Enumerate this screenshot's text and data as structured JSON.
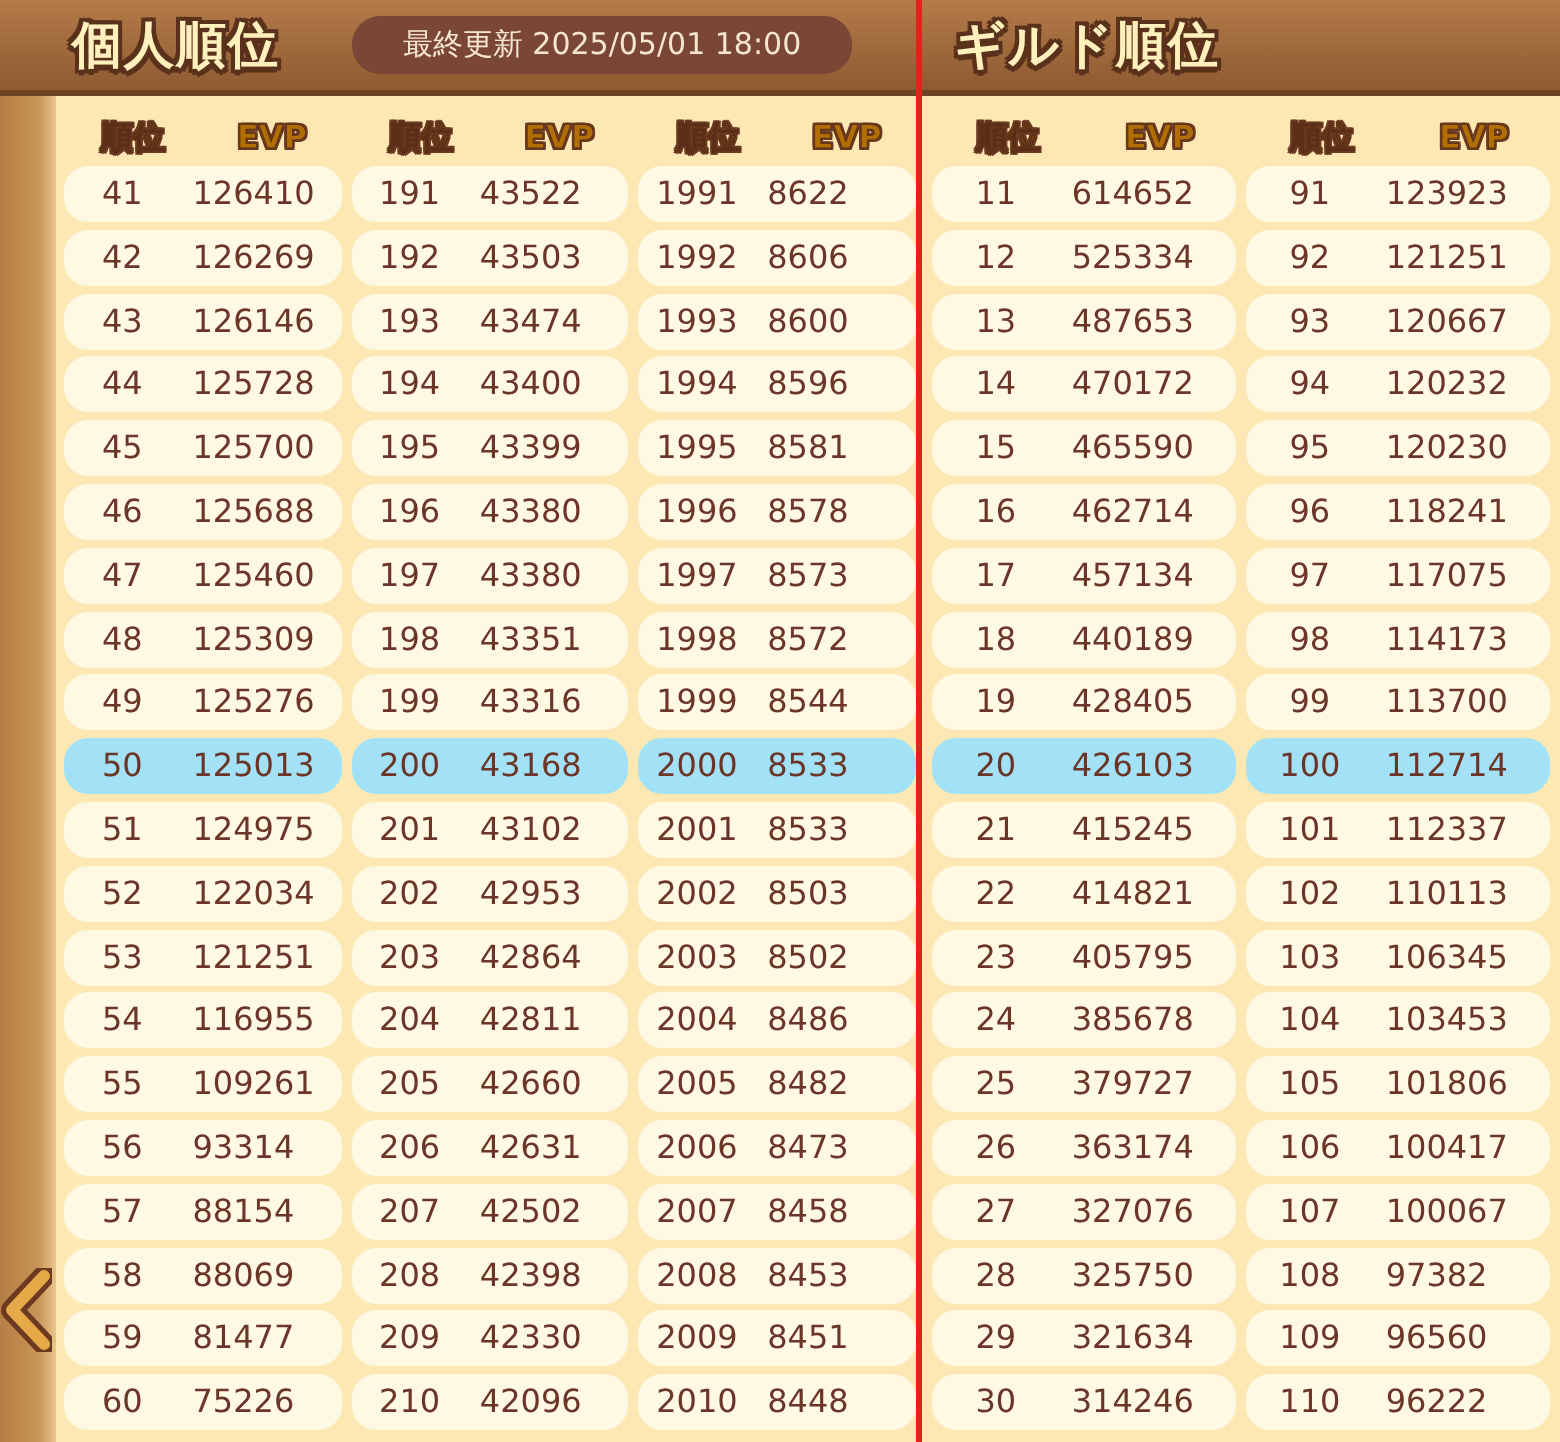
{
  "personal": {
    "title": "個人順位",
    "updated": "最終更新 2025/05/01 18:00",
    "columns": [
      {
        "rank_header": "順位",
        "evp_header": "EVP",
        "rows": [
          {
            "rank": "41",
            "evp": "126410",
            "selected": false
          },
          {
            "rank": "42",
            "evp": "126269",
            "selected": false
          },
          {
            "rank": "43",
            "evp": "126146",
            "selected": false
          },
          {
            "rank": "44",
            "evp": "125728",
            "selected": false
          },
          {
            "rank": "45",
            "evp": "125700",
            "selected": false
          },
          {
            "rank": "46",
            "evp": "125688",
            "selected": false
          },
          {
            "rank": "47",
            "evp": "125460",
            "selected": false
          },
          {
            "rank": "48",
            "evp": "125309",
            "selected": false
          },
          {
            "rank": "49",
            "evp": "125276",
            "selected": false
          },
          {
            "rank": "50",
            "evp": "125013",
            "selected": true
          },
          {
            "rank": "51",
            "evp": "124975",
            "selected": false
          },
          {
            "rank": "52",
            "evp": "122034",
            "selected": false
          },
          {
            "rank": "53",
            "evp": "121251",
            "selected": false
          },
          {
            "rank": "54",
            "evp": "116955",
            "selected": false
          },
          {
            "rank": "55",
            "evp": "109261",
            "selected": false
          },
          {
            "rank": "56",
            "evp": "93314",
            "selected": false
          },
          {
            "rank": "57",
            "evp": "88154",
            "selected": false
          },
          {
            "rank": "58",
            "evp": "88069",
            "selected": false
          },
          {
            "rank": "59",
            "evp": "81477",
            "selected": false
          },
          {
            "rank": "60",
            "evp": "75226",
            "selected": false
          }
        ]
      },
      {
        "rank_header": "順位",
        "evp_header": "EVP",
        "rows": [
          {
            "rank": "191",
            "evp": "43522",
            "selected": false
          },
          {
            "rank": "192",
            "evp": "43503",
            "selected": false
          },
          {
            "rank": "193",
            "evp": "43474",
            "selected": false
          },
          {
            "rank": "194",
            "evp": "43400",
            "selected": false
          },
          {
            "rank": "195",
            "evp": "43399",
            "selected": false
          },
          {
            "rank": "196",
            "evp": "43380",
            "selected": false
          },
          {
            "rank": "197",
            "evp": "43380",
            "selected": false
          },
          {
            "rank": "198",
            "evp": "43351",
            "selected": false
          },
          {
            "rank": "199",
            "evp": "43316",
            "selected": false
          },
          {
            "rank": "200",
            "evp": "43168",
            "selected": true
          },
          {
            "rank": "201",
            "evp": "43102",
            "selected": false
          },
          {
            "rank": "202",
            "evp": "42953",
            "selected": false
          },
          {
            "rank": "203",
            "evp": "42864",
            "selected": false
          },
          {
            "rank": "204",
            "evp": "42811",
            "selected": false
          },
          {
            "rank": "205",
            "evp": "42660",
            "selected": false
          },
          {
            "rank": "206",
            "evp": "42631",
            "selected": false
          },
          {
            "rank": "207",
            "evp": "42502",
            "selected": false
          },
          {
            "rank": "208",
            "evp": "42398",
            "selected": false
          },
          {
            "rank": "209",
            "evp": "42330",
            "selected": false
          },
          {
            "rank": "210",
            "evp": "42096",
            "selected": false
          }
        ]
      },
      {
        "rank_header": "順位",
        "evp_header": "EVP",
        "rows": [
          {
            "rank": "1991",
            "evp": "8622",
            "selected": false
          },
          {
            "rank": "1992",
            "evp": "8606",
            "selected": false
          },
          {
            "rank": "1993",
            "evp": "8600",
            "selected": false
          },
          {
            "rank": "1994",
            "evp": "8596",
            "selected": false
          },
          {
            "rank": "1995",
            "evp": "8581",
            "selected": false
          },
          {
            "rank": "1996",
            "evp": "8578",
            "selected": false
          },
          {
            "rank": "1997",
            "evp": "8573",
            "selected": false
          },
          {
            "rank": "1998",
            "evp": "8572",
            "selected": false
          },
          {
            "rank": "1999",
            "evp": "8544",
            "selected": false
          },
          {
            "rank": "2000",
            "evp": "8533",
            "selected": true
          },
          {
            "rank": "2001",
            "evp": "8533",
            "selected": false
          },
          {
            "rank": "2002",
            "evp": "8503",
            "selected": false
          },
          {
            "rank": "2003",
            "evp": "8502",
            "selected": false
          },
          {
            "rank": "2004",
            "evp": "8486",
            "selected": false
          },
          {
            "rank": "2005",
            "evp": "8482",
            "selected": false
          },
          {
            "rank": "2006",
            "evp": "8473",
            "selected": false
          },
          {
            "rank": "2007",
            "evp": "8458",
            "selected": false
          },
          {
            "rank": "2008",
            "evp": "8453",
            "selected": false
          },
          {
            "rank": "2009",
            "evp": "8451",
            "selected": false
          },
          {
            "rank": "2010",
            "evp": "8448",
            "selected": false
          }
        ]
      }
    ]
  },
  "guild": {
    "title": "ギルド順位",
    "columns": [
      {
        "rank_header": "順位",
        "evp_header": "EVP",
        "rows": [
          {
            "rank": "11",
            "evp": "614652",
            "selected": false
          },
          {
            "rank": "12",
            "evp": "525334",
            "selected": false
          },
          {
            "rank": "13",
            "evp": "487653",
            "selected": false
          },
          {
            "rank": "14",
            "evp": "470172",
            "selected": false
          },
          {
            "rank": "15",
            "evp": "465590",
            "selected": false
          },
          {
            "rank": "16",
            "evp": "462714",
            "selected": false
          },
          {
            "rank": "17",
            "evp": "457134",
            "selected": false
          },
          {
            "rank": "18",
            "evp": "440189",
            "selected": false
          },
          {
            "rank": "19",
            "evp": "428405",
            "selected": false
          },
          {
            "rank": "20",
            "evp": "426103",
            "selected": true
          },
          {
            "rank": "21",
            "evp": "415245",
            "selected": false
          },
          {
            "rank": "22",
            "evp": "414821",
            "selected": false
          },
          {
            "rank": "23",
            "evp": "405795",
            "selected": false
          },
          {
            "rank": "24",
            "evp": "385678",
            "selected": false
          },
          {
            "rank": "25",
            "evp": "379727",
            "selected": false
          },
          {
            "rank": "26",
            "evp": "363174",
            "selected": false
          },
          {
            "rank": "27",
            "evp": "327076",
            "selected": false
          },
          {
            "rank": "28",
            "evp": "325750",
            "selected": false
          },
          {
            "rank": "29",
            "evp": "321634",
            "selected": false
          },
          {
            "rank": "30",
            "evp": "314246",
            "selected": false
          }
        ]
      },
      {
        "rank_header": "順位",
        "evp_header": "EVP",
        "rows": [
          {
            "rank": "91",
            "evp": "123923",
            "selected": false
          },
          {
            "rank": "92",
            "evp": "121251",
            "selected": false
          },
          {
            "rank": "93",
            "evp": "120667",
            "selected": false
          },
          {
            "rank": "94",
            "evp": "120232",
            "selected": false
          },
          {
            "rank": "95",
            "evp": "120230",
            "selected": false
          },
          {
            "rank": "96",
            "evp": "118241",
            "selected": false
          },
          {
            "rank": "97",
            "evp": "117075",
            "selected": false
          },
          {
            "rank": "98",
            "evp": "114173",
            "selected": false
          },
          {
            "rank": "99",
            "evp": "113700",
            "selected": false
          },
          {
            "rank": "100",
            "evp": "112714",
            "selected": true
          },
          {
            "rank": "101",
            "evp": "112337",
            "selected": false
          },
          {
            "rank": "102",
            "evp": "110113",
            "selected": false
          },
          {
            "rank": "103",
            "evp": "106345",
            "selected": false
          },
          {
            "rank": "104",
            "evp": "103453",
            "selected": false
          },
          {
            "rank": "105",
            "evp": "101806",
            "selected": false
          },
          {
            "rank": "106",
            "evp": "100417",
            "selected": false
          },
          {
            "rank": "107",
            "evp": "100067",
            "selected": false
          },
          {
            "rank": "108",
            "evp": "97382",
            "selected": false
          },
          {
            "rank": "109",
            "evp": "96560",
            "selected": false
          },
          {
            "rank": "110",
            "evp": "96222",
            "selected": false
          }
        ]
      }
    ]
  }
}
